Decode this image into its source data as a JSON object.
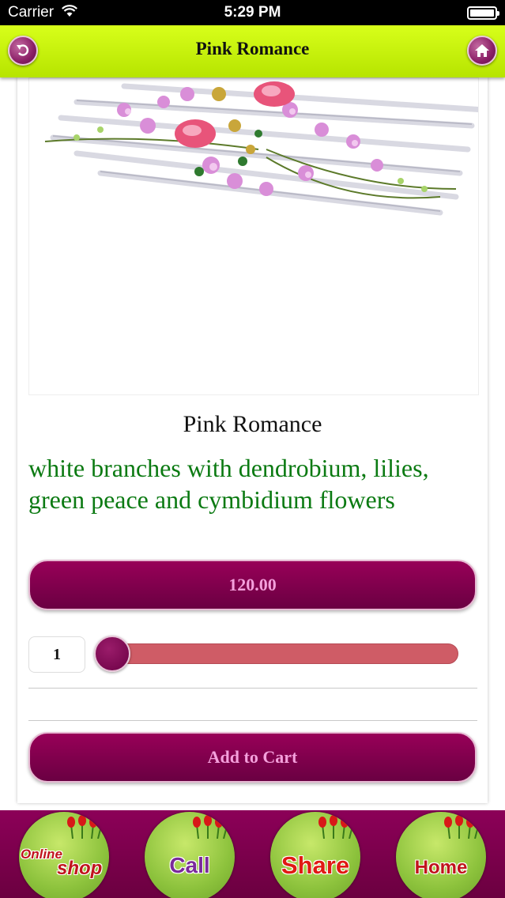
{
  "status_bar": {
    "carrier": "Carrier",
    "time": "5:29 PM"
  },
  "nav": {
    "title": "Pink Romance",
    "back_icon": "back-arrow-icon",
    "home_icon": "home-icon"
  },
  "product": {
    "title": "Pink Romance",
    "description": "white branches with dendrobium, lilies, green peace and cymbidium flowers",
    "price": "120.00",
    "quantity": "1",
    "quantity_slider_level": 0,
    "add_to_cart_label": "Add to Cart"
  },
  "tabs": {
    "shop_line1": "Online",
    "shop_line2": "shop",
    "call": "Call",
    "share": "Share",
    "home": "Home"
  },
  "colors": {
    "nav_bar": "#c8f000",
    "accent": "#7a004a",
    "description_text": "#0b7a12",
    "slider_track": "#cf5c66"
  }
}
